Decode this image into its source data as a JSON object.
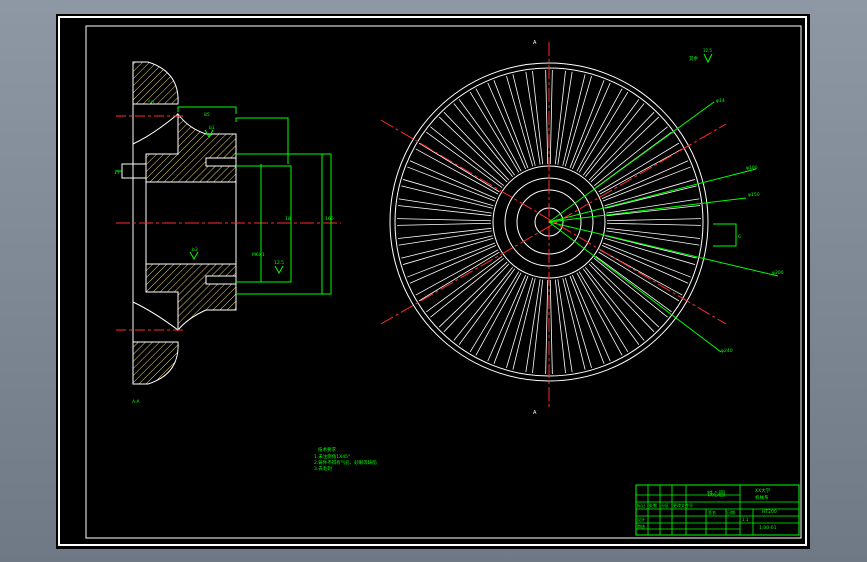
{
  "drawing": {
    "section_label": "A-A",
    "section_mark_top": "A",
    "section_mark_bottom": "A",
    "roughness_note": "其余",
    "roughness_symbol": "12.5"
  },
  "dimensions": {
    "left_view": [
      "50",
      "85",
      "b1",
      "17",
      "18",
      "160",
      "b3",
      "M6X1",
      "12.5"
    ],
    "right_view": [
      "φ14",
      "φ100",
      "φ150",
      "φ200",
      "φ240",
      "6"
    ]
  },
  "notes": {
    "heading": "技术要求",
    "lines": [
      "1.未注倒角1X45°",
      "2.铸件不得有气孔、砂眼等缺陷",
      "3.去毛刺"
    ]
  },
  "title_block": {
    "part_name": "铁心圆",
    "school": "XX大学",
    "unit": "机械系",
    "material": "HT200",
    "drawing_no": "1:00-01",
    "scale": "1:1",
    "designer": "设计",
    "checker": "审核",
    "rows": [
      "标记",
      "处数",
      "分区",
      "更改文件号",
      "签名",
      "日期"
    ]
  },
  "colors": {
    "background": "#000000",
    "sheet_border": "#ffffff",
    "centerline": "#ff2a2a",
    "outline": "#ffffff",
    "dimension": "#00ff00",
    "hatch": "#e8d27a"
  }
}
